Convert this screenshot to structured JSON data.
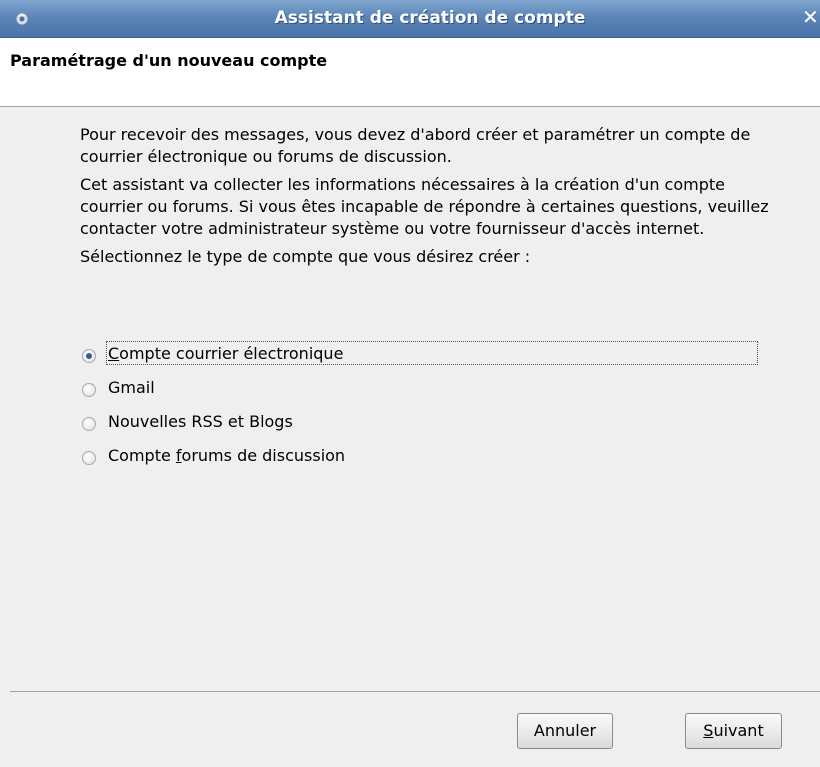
{
  "window": {
    "title": "Assistant de création de compte",
    "close_glyph": "✕"
  },
  "header": {
    "title": "Paramétrage d'un nouveau compte"
  },
  "content": {
    "paragraph1": "Pour recevoir des messages, vous devez d'abord créer et paramétrer un compte de courrier électronique ou forums de discussion.",
    "paragraph2": "Cet assistant va collecter les informations nécessaires à la création d'un compte courrier ou forums. Si vous êtes incapable de répondre à certaines questions, veuillez contacter votre administrateur système ou votre fournisseur d'accès internet.",
    "prompt": "Sélectionnez le type de compte que vous désirez créer :"
  },
  "account_types": [
    {
      "label_pre": "",
      "accel": "C",
      "label_post": "ompte courrier électronique",
      "checked": true
    },
    {
      "label_pre": "Gmail",
      "accel": "",
      "label_post": "",
      "checked": false
    },
    {
      "label_pre": "Nouvelles RSS et Blogs",
      "accel": "",
      "label_post": "",
      "checked": false
    },
    {
      "label_pre": "Compte ",
      "accel": "f",
      "label_post": "orums de discussion",
      "checked": false
    }
  ],
  "buttons": {
    "cancel": "Annuler",
    "next_accel": "S",
    "next_rest": "uivant"
  },
  "icons": {
    "app": "thunderbird-icon",
    "close": "close-icon"
  }
}
